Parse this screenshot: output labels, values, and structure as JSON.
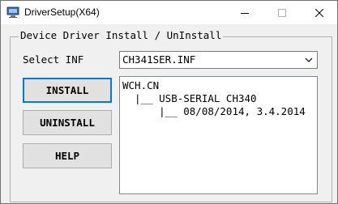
{
  "window": {
    "title": "DriverSetup(X64)",
    "controls": {
      "minimize": "minimize",
      "maximize": "maximize",
      "close": "close"
    }
  },
  "group": {
    "title": "Device Driver Install / UnInstall"
  },
  "select_inf": {
    "label": "Select INF",
    "selected": "CH341SER.INF"
  },
  "buttons": {
    "install": "INSTALL",
    "uninstall": "UNINSTALL",
    "help": "HELP"
  },
  "info": {
    "lines": [
      "WCH.CN",
      "  |__ USB-SERIAL CH340",
      "      |__ 08/08/2014, 3.4.2014"
    ]
  },
  "colors": {
    "focus_border": "#0078d7",
    "window_bg": "#f0f0f0",
    "button_bg": "#e1e1e1"
  }
}
